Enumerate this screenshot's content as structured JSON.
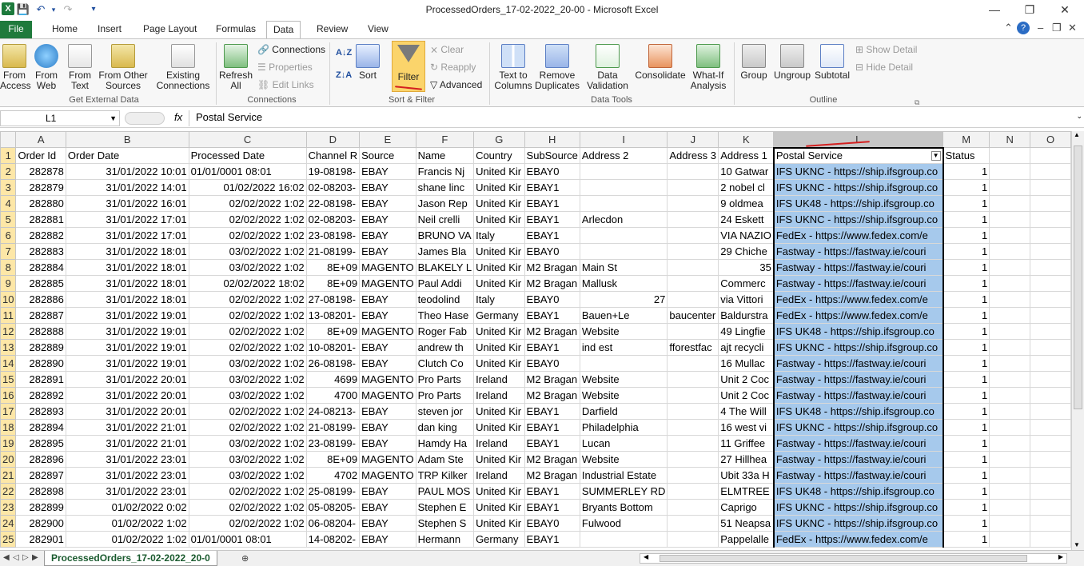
{
  "window": {
    "title": "ProcessedOrders_17-02-2022_20-00  -  Microsoft Excel"
  },
  "tabs": [
    "File",
    "Home",
    "Insert",
    "Page Layout",
    "Formulas",
    "Data",
    "Review",
    "View"
  ],
  "ribbon": {
    "get_external": {
      "from_access": "From Access",
      "from_web": "From Web",
      "from_text": "From Text",
      "from_other": "From Other Sources",
      "existing": "Existing Connections",
      "group": "Get External Data"
    },
    "connections": {
      "refresh": "Refresh All",
      "connections": "Connections",
      "properties": "Properties",
      "edit_links": "Edit Links",
      "group": "Connections"
    },
    "sort_filter": {
      "sort_az": "A↓Z",
      "sort_za": "Z↓A",
      "sort": "Sort",
      "filter": "Filter",
      "clear": "Clear",
      "reapply": "Reapply",
      "advanced": "Advanced",
      "group": "Sort & Filter"
    },
    "data_tools": {
      "text_to_columns": "Text to Columns",
      "remove_dup": "Remove Duplicates",
      "validation": "Data Validation",
      "consolidate": "Consolidate",
      "whatif": "What-If Analysis",
      "group": "Data Tools"
    },
    "outline": {
      "group_btn": "Group",
      "ungroup": "Ungroup",
      "subtotal": "Subtotal",
      "show_detail": "Show Detail",
      "hide_detail": "Hide Detail",
      "group": "Outline"
    }
  },
  "formula_bar": {
    "name_box": "L1",
    "fx": "fx",
    "value": "Postal Service"
  },
  "columns": [
    "A",
    "B",
    "C",
    "D",
    "E",
    "F",
    "G",
    "H",
    "I",
    "J",
    "K",
    "L",
    "M",
    "N",
    "O"
  ],
  "headers": [
    "Order Id",
    "Order Date",
    "Processed Date",
    "Channel R",
    "Source",
    "Name",
    "Country",
    "SubSource",
    "Address 2",
    "Address 3",
    "Address 1",
    "Postal Service",
    "Status",
    "",
    ""
  ],
  "rows": [
    [
      "282878",
      "31/01/2022 10:01",
      "01/01/0001 08:01",
      "19-08198-",
      "EBAY",
      "Francis Nj",
      "United Kir",
      "EBAY0",
      "",
      "",
      "10 Gatwar",
      "IFS UKNC - https://ship.ifsgroup.co",
      "1"
    ],
    [
      "282879",
      "31/01/2022 14:01",
      "01/02/2022 16:02",
      "02-08203-",
      "EBAY",
      "shane linc",
      "United Kir",
      "EBAY1",
      "",
      "",
      "2 nobel cl",
      "IFS UKNC - https://ship.ifsgroup.co",
      "1"
    ],
    [
      "282880",
      "31/01/2022 16:01",
      "02/02/2022 1:02",
      "22-08198-",
      "EBAY",
      "Jason  Rep",
      "United Kir",
      "EBAY1",
      "",
      "",
      "9 oldmea",
      "IFS UK48 - https://ship.ifsgroup.co",
      "1"
    ],
    [
      "282881",
      "31/01/2022 17:01",
      "02/02/2022 1:02",
      "02-08203-",
      "EBAY",
      "Neil crelli",
      "United Kir",
      "EBAY1",
      "Arlecdon",
      "",
      "24 Eskett",
      "IFS UKNC - https://ship.ifsgroup.co",
      "1"
    ],
    [
      "282882",
      "31/01/2022 17:01",
      "02/02/2022 1:02",
      "23-08198-",
      "EBAY",
      "BRUNO VA",
      "Italy",
      "EBAY1",
      "",
      "",
      "VIA NAZIO",
      "FedEx - https://www.fedex.com/e",
      "1"
    ],
    [
      "282883",
      "31/01/2022 18:01",
      "03/02/2022 1:02",
      "21-08199-",
      "EBAY",
      "James Bla",
      "United Kir",
      "EBAY0",
      "",
      "",
      "29 Chiche",
      "Fastway - https://fastway.ie/couri",
      "1"
    ],
    [
      "282884",
      "31/01/2022 18:01",
      "03/02/2022 1:02",
      "8E+09",
      "MAGENTO",
      "BLAKELY L",
      "United Kir",
      "M2 Bragan",
      "Main St",
      "",
      "35",
      "Fastway - https://fastway.ie/couri",
      "1"
    ],
    [
      "282885",
      "31/01/2022 18:01",
      "02/02/2022 18:02",
      "8E+09",
      "MAGENTO",
      "Paul Addi",
      "United Kir",
      "M2 Bragan",
      "Mallusk",
      "",
      "Commerc",
      "Fastway - https://fastway.ie/couri",
      "1"
    ],
    [
      "282886",
      "31/01/2022 18:01",
      "02/02/2022 1:02",
      "27-08198-",
      "EBAY",
      "teodolind",
      "Italy",
      "EBAY0",
      "27",
      "",
      "via Vittori",
      "FedEx - https://www.fedex.com/e",
      "1"
    ],
    [
      "282887",
      "31/01/2022 19:01",
      "02/02/2022 1:02",
      "13-08201-",
      "EBAY",
      "Theo Hase",
      "Germany",
      "EBAY1",
      "Bauen+Le",
      "baucenter",
      "Baldurstra",
      "FedEx - https://www.fedex.com/e",
      "1"
    ],
    [
      "282888",
      "31/01/2022 19:01",
      "02/02/2022 1:02",
      "8E+09",
      "MAGENTO",
      "Roger Fab",
      "United Kir",
      "M2 Bragan",
      "Website",
      "",
      "49 Lingfie",
      "IFS UK48 - https://ship.ifsgroup.co",
      "1"
    ],
    [
      "282889",
      "31/01/2022 19:01",
      "02/02/2022 1:02",
      "10-08201-",
      "EBAY",
      "andrew th",
      "United Kir",
      "EBAY1",
      "ind est",
      "fforestfac",
      "ajt recycli",
      "IFS UKNC - https://ship.ifsgroup.co",
      "1"
    ],
    [
      "282890",
      "31/01/2022 19:01",
      "03/02/2022 1:02",
      "26-08198-",
      "EBAY",
      "Clutch Co",
      "United Kir",
      "EBAY0",
      "",
      "",
      "16 Mullac",
      "Fastway - https://fastway.ie/couri",
      "1"
    ],
    [
      "282891",
      "31/01/2022 20:01",
      "03/02/2022 1:02",
      "4699",
      "MAGENTO",
      "Pro Parts",
      "Ireland",
      "M2 Bragan",
      "Website",
      "",
      "Unit 2 Coc",
      "Fastway - https://fastway.ie/couri",
      "1"
    ],
    [
      "282892",
      "31/01/2022 20:01",
      "03/02/2022 1:02",
      "4700",
      "MAGENTO",
      "Pro Parts",
      "Ireland",
      "M2 Bragan",
      "Website",
      "",
      "Unit 2 Coc",
      "Fastway - https://fastway.ie/couri",
      "1"
    ],
    [
      "282893",
      "31/01/2022 20:01",
      "02/02/2022 1:02",
      "24-08213-",
      "EBAY",
      "steven jor",
      "United Kir",
      "EBAY1",
      "Darfield",
      "",
      "4 The Will",
      "IFS UK48 - https://ship.ifsgroup.co",
      "1"
    ],
    [
      "282894",
      "31/01/2022 21:01",
      "02/02/2022 1:02",
      "21-08199-",
      "EBAY",
      "dan  king",
      "United Kir",
      "EBAY1",
      "Philadelphia",
      "",
      "16 west vi",
      "IFS UKNC - https://ship.ifsgroup.co",
      "1"
    ],
    [
      "282895",
      "31/01/2022 21:01",
      "03/02/2022 1:02",
      "23-08199-",
      "EBAY",
      "Hamdy Ha",
      "Ireland",
      "EBAY1",
      "Lucan",
      "",
      "11 Griffee",
      "Fastway - https://fastway.ie/couri",
      "1"
    ],
    [
      "282896",
      "31/01/2022 23:01",
      "03/02/2022 1:02",
      "8E+09",
      "MAGENTO",
      "Adam Ste",
      "United Kir",
      "M2 Bragan",
      "Website",
      "",
      "27 Hillhea",
      "Fastway - https://fastway.ie/couri",
      "1"
    ],
    [
      "282897",
      "31/01/2022 23:01",
      "03/02/2022 1:02",
      "4702",
      "MAGENTO",
      "TRP Kilker",
      "Ireland",
      "M2 Bragan",
      "Industrial Estate",
      "",
      "Ubit 33a H",
      "Fastway - https://fastway.ie/couri",
      "1"
    ],
    [
      "282898",
      "31/01/2022 23:01",
      "02/02/2022 1:02",
      "25-08199-",
      "EBAY",
      "PAUL MOS",
      "United Kir",
      "EBAY1",
      "SUMMERLEY RD",
      "",
      "ELMTREE",
      "IFS UK48 - https://ship.ifsgroup.co",
      "1"
    ],
    [
      "282899",
      "01/02/2022 0:02",
      "02/02/2022 1:02",
      "05-08205-",
      "EBAY",
      "Stephen E",
      "United Kir",
      "EBAY1",
      "Bryants Bottom",
      "",
      "Caprigo",
      "IFS UKNC - https://ship.ifsgroup.co",
      "1"
    ],
    [
      "282900",
      "01/02/2022 1:02",
      "02/02/2022 1:02",
      "06-08204-",
      "EBAY",
      "Stephen S",
      "United Kir",
      "EBAY0",
      "Fulwood",
      "",
      "51 Neapsa",
      "IFS UKNC - https://ship.ifsgroup.co",
      "1"
    ],
    [
      "282901",
      "01/02/2022 1:02",
      "01/01/0001 08:01",
      "14-08202-",
      "EBAY",
      "Hermann",
      "Germany",
      "EBAY1",
      "",
      "",
      "Pappelalle",
      "FedEx - https://www.fedex.com/e",
      "1"
    ]
  ],
  "sheet_tab": "ProcessedOrders_17-02-2022_20-0",
  "colors": {
    "excel_green": "#1f7a3c",
    "selection": "#a6c9ec",
    "row_header": "#fde7a7"
  }
}
